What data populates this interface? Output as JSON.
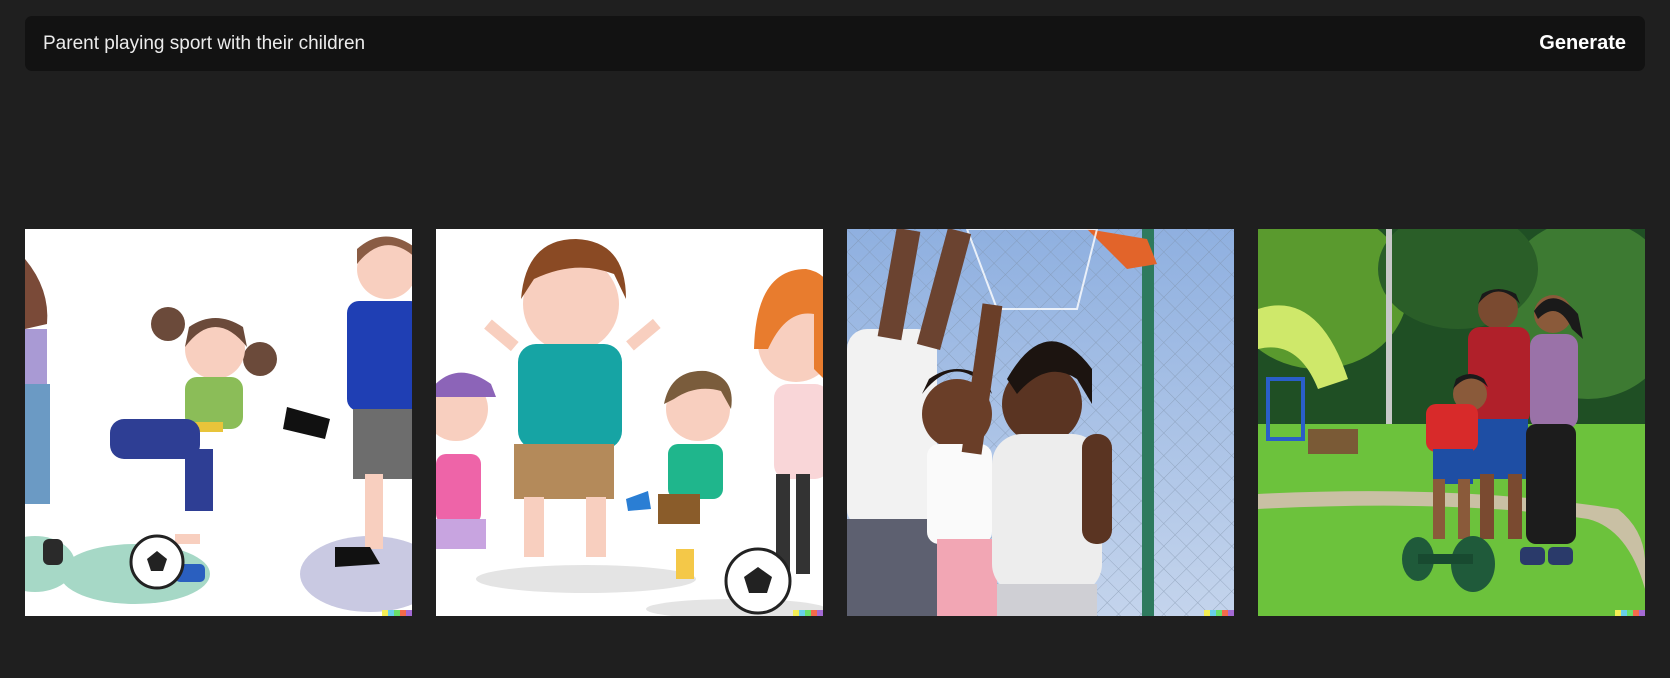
{
  "prompt": {
    "value": "Parent playing sport with their children"
  },
  "actions": {
    "generate_label": "Generate"
  },
  "results": [
    {
      "icon": "cartoon-family-soccer-image"
    },
    {
      "icon": "cartoon-kids-cheering-soccer-image"
    },
    {
      "icon": "photo-family-basketball-image"
    },
    {
      "icon": "photo-family-park-exercise-image"
    }
  ],
  "watermark_colors": [
    "#f4ee54",
    "#68d0ea",
    "#6ae06a",
    "#f46a4a",
    "#a46ad4"
  ]
}
